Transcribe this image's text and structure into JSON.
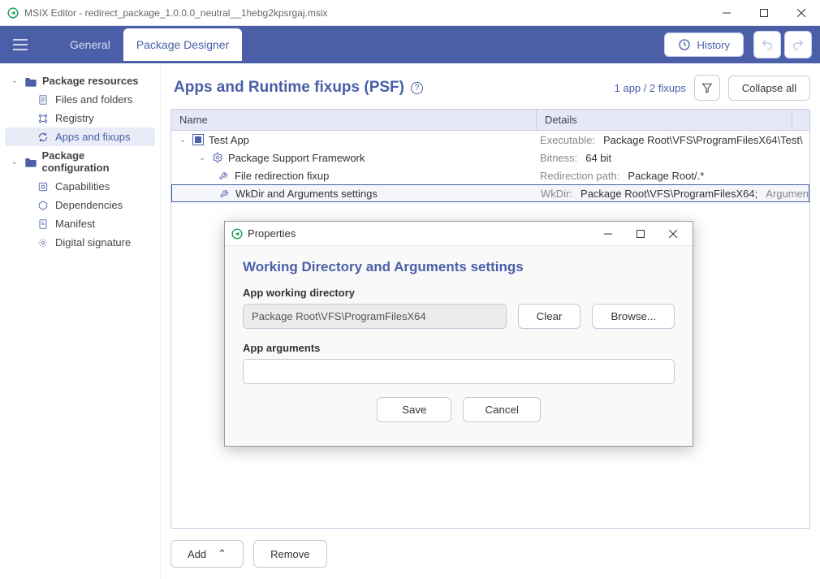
{
  "app": {
    "title": "MSIX Editor - redirect_package_1.0.0.0_neutral__1hebg2kpsrgaj.msix"
  },
  "nav": {
    "tabs": [
      "General",
      "Package Designer"
    ],
    "active": 1,
    "history_label": "History"
  },
  "sidebar": {
    "package_resources": "Package resources",
    "files_and_folders": "Files and folders",
    "registry": "Registry",
    "apps_and_fixups": "Apps and fixups",
    "package_configuration": "Package configuration",
    "capabilities": "Capabilities",
    "dependencies": "Dependencies",
    "manifest": "Manifest",
    "digital_signature": "Digital signature"
  },
  "main": {
    "title": "Apps and Runtime fixups (PSF)",
    "count": "1 app / 2 fixups",
    "collapse": "Collapse all",
    "columns": {
      "name": "Name",
      "details": "Details"
    },
    "rows": [
      {
        "name": "Test App",
        "detail_label": "Executable:",
        "detail_value": "Package Root\\VFS\\ProgramFilesX64\\Test\\"
      },
      {
        "name": "Package Support Framework",
        "detail_label": "Bitness:",
        "detail_value": "64 bit"
      },
      {
        "name": "File redirection fixup",
        "detail_label": "Redirection path:",
        "detail_value": "Package Root/.*"
      },
      {
        "name": "WkDir and Arguments settings",
        "detail_label": "WkDir:",
        "detail_value": "Package Root\\VFS\\ProgramFilesX64;",
        "detail_extra": "Argumen"
      }
    ],
    "add": "Add",
    "remove": "Remove"
  },
  "dialog": {
    "title": "Properties",
    "heading": "Working Directory and Arguments settings",
    "wd_label": "App working directory",
    "wd_value": "Package Root\\VFS\\ProgramFilesX64",
    "clear": "Clear",
    "browse": "Browse...",
    "args_label": "App arguments",
    "args_value": "",
    "save": "Save",
    "cancel": "Cancel"
  }
}
